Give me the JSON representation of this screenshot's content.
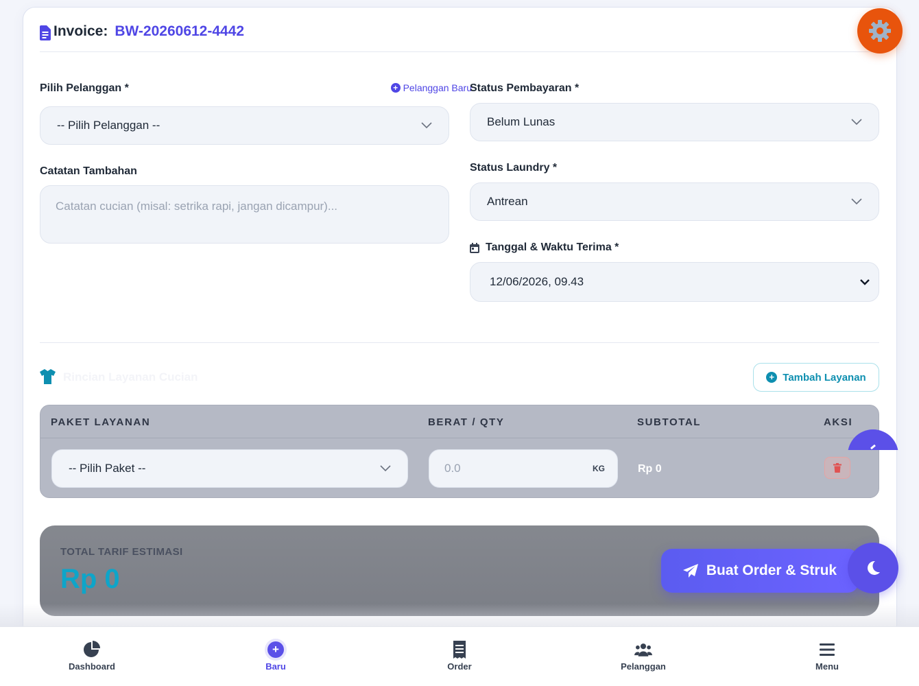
{
  "invoice": {
    "label": "Invoice:",
    "number": "BW-20260612-4442"
  },
  "form": {
    "customer_label": "Pilih Pelanggan *",
    "new_customer_link": "Pelanggan Baru",
    "customer_select_value": "-- Pilih Pelanggan --",
    "notes_label": "Catatan Tambahan",
    "notes_placeholder": "Catatan cucian (misal: setrika rapi, jangan dicampur)...",
    "payment_status_label": "Status Pembayaran *",
    "payment_status_value": "Belum Lunas",
    "laundry_status_label": "Status Laundry *",
    "laundry_status_value": "Antrean",
    "received_datetime_label": "Tanggal & Waktu Terima *",
    "received_datetime_value": "12/06/2026, 09.43"
  },
  "services": {
    "section_title": "Rincian Layanan Cucian",
    "add_button": "Tambah Layanan",
    "columns": [
      "PAKET LAYANAN",
      "BERAT / QTY",
      "SUBTOTAL",
      "AKSI"
    ],
    "rows": [
      {
        "package_value": "-- Pilih Paket --",
        "qty_placeholder": "0.0",
        "unit": "KG",
        "subtotal": "Rp 0"
      }
    ]
  },
  "total": {
    "label": "TOTAL TARIF ESTIMASI",
    "value": "Rp 0",
    "submit_button": "Buat Order & Struk"
  },
  "nav": {
    "items": [
      {
        "label": "Dashboard",
        "icon": "chart-pie-icon",
        "active": false
      },
      {
        "label": "Baru",
        "icon": "plus-circle-icon",
        "active": true
      },
      {
        "label": "Order",
        "icon": "receipt-icon",
        "active": false
      },
      {
        "label": "Pelanggan",
        "icon": "users-icon",
        "active": false
      },
      {
        "label": "Menu",
        "icon": "menu-icon",
        "active": false
      }
    ]
  },
  "colors": {
    "accent": "#4f46e5",
    "teal": "#0e8fb0",
    "gear_fab": "#e8540c",
    "delete": "#e05252"
  }
}
